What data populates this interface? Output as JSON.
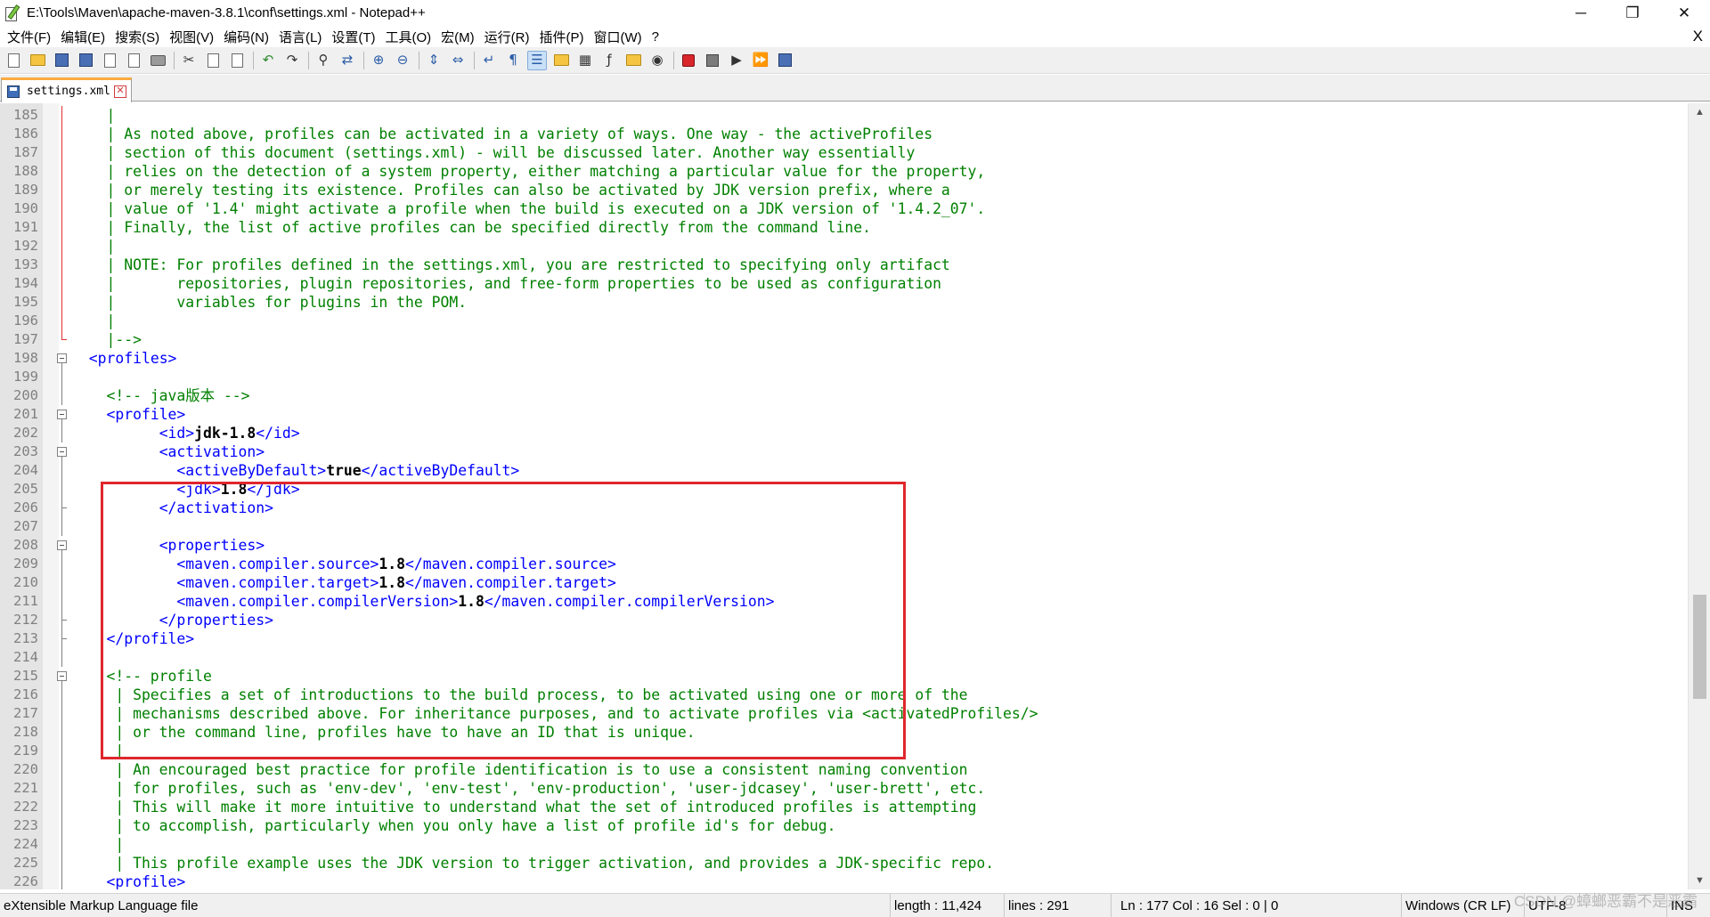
{
  "window": {
    "title": "E:\\Tools\\Maven\\apache-maven-3.8.1\\conf\\settings.xml - Notepad++",
    "minimize_label": "─",
    "restore_label": "❐",
    "close_label": "✕"
  },
  "menu": {
    "items": [
      "文件(F)",
      "编辑(E)",
      "搜索(S)",
      "视图(V)",
      "编码(N)",
      "语言(L)",
      "设置(T)",
      "工具(O)",
      "宏(M)",
      "运行(R)",
      "插件(P)",
      "窗口(W)",
      "?"
    ],
    "close_label": "X"
  },
  "toolbar": {
    "buttons": [
      {
        "name": "new-file-icon",
        "kind": "doc"
      },
      {
        "name": "open-file-icon",
        "kind": "folder"
      },
      {
        "name": "save-icon",
        "kind": "disk"
      },
      {
        "name": "save-all-icon",
        "kind": "disk"
      },
      {
        "name": "close-file-icon",
        "kind": "doc"
      },
      {
        "name": "close-all-icon",
        "kind": "doc"
      },
      {
        "name": "print-icon",
        "kind": "print"
      },
      {
        "sep": true
      },
      {
        "name": "cut-icon",
        "kind": "glyph",
        "glyph": "✂",
        "tone": "dark"
      },
      {
        "name": "copy-icon",
        "kind": "doc"
      },
      {
        "name": "paste-icon",
        "kind": "doc"
      },
      {
        "sep": true
      },
      {
        "name": "undo-icon",
        "kind": "glyph",
        "glyph": "↶",
        "tone": "green"
      },
      {
        "name": "redo-icon",
        "kind": "glyph",
        "glyph": "↷",
        "tone": "dark"
      },
      {
        "sep": true
      },
      {
        "name": "find-icon",
        "kind": "glyph",
        "glyph": "⚲",
        "tone": "dark"
      },
      {
        "name": "replace-icon",
        "kind": "glyph",
        "glyph": "⇄",
        "tone": "blue"
      },
      {
        "sep": true
      },
      {
        "name": "zoom-in-icon",
        "kind": "glyph",
        "glyph": "⊕",
        "tone": "blue"
      },
      {
        "name": "zoom-out-icon",
        "kind": "glyph",
        "glyph": "⊖",
        "tone": "blue"
      },
      {
        "sep": true
      },
      {
        "name": "sync-vertical-icon",
        "kind": "glyph",
        "glyph": "⇕",
        "tone": "blue"
      },
      {
        "name": "sync-horizontal-icon",
        "kind": "glyph",
        "glyph": "⇔",
        "tone": "blue"
      },
      {
        "sep": true
      },
      {
        "name": "word-wrap-icon",
        "kind": "glyph",
        "glyph": "↵",
        "tone": "blue"
      },
      {
        "name": "show-all-chars-icon",
        "kind": "glyph",
        "glyph": "¶",
        "tone": "blue"
      },
      {
        "name": "indent-guide-icon",
        "kind": "glyph",
        "glyph": "☰",
        "tone": "blue",
        "active": true
      },
      {
        "name": "user-language-icon",
        "kind": "folder"
      },
      {
        "name": "document-map-icon",
        "kind": "glyph",
        "glyph": "▦",
        "tone": "dark"
      },
      {
        "name": "function-list-icon",
        "kind": "glyph",
        "glyph": "ƒ",
        "tone": "dark"
      },
      {
        "name": "folder-workspace-icon",
        "kind": "folder"
      },
      {
        "name": "monitoring-icon",
        "kind": "glyph",
        "glyph": "◉",
        "tone": "dark"
      },
      {
        "sep": true
      },
      {
        "name": "record-macro-icon",
        "kind": "red"
      },
      {
        "name": "stop-recording-icon",
        "kind": "gray"
      },
      {
        "name": "playback-macro-icon",
        "kind": "glyph",
        "glyph": "▶",
        "tone": "dark"
      },
      {
        "name": "run-macro-multiple-icon",
        "kind": "glyph",
        "glyph": "⏩",
        "tone": "blue"
      },
      {
        "name": "save-macro-icon",
        "kind": "disk"
      }
    ]
  },
  "tab": {
    "label": "settings.xml",
    "close_label": "✕"
  },
  "editor": {
    "lines": [
      {
        "n": "185",
        "fold": "red",
        "segs": [
          {
            "t": "    |",
            "c": "comment"
          }
        ]
      },
      {
        "n": "186",
        "fold": "red",
        "segs": [
          {
            "t": "    | As noted above, profiles can be activated in a variety of ways. One way - the activeProfiles",
            "c": "comment"
          }
        ]
      },
      {
        "n": "187",
        "fold": "red",
        "segs": [
          {
            "t": "    | section of this document (settings.xml) - will be discussed later. Another way essentially",
            "c": "comment"
          }
        ]
      },
      {
        "n": "188",
        "fold": "red",
        "segs": [
          {
            "t": "    | relies on the detection of a system property, either matching a particular value for the property,",
            "c": "comment"
          }
        ]
      },
      {
        "n": "189",
        "fold": "red",
        "segs": [
          {
            "t": "    | or merely testing its existence. Profiles can also be activated by JDK version prefix, where a",
            "c": "comment"
          }
        ]
      },
      {
        "n": "190",
        "fold": "red",
        "segs": [
          {
            "t": "    | value of '1.4' might activate a profile when the build is executed on a JDK version of '1.4.2_07'.",
            "c": "comment"
          }
        ]
      },
      {
        "n": "191",
        "fold": "red",
        "segs": [
          {
            "t": "    | Finally, the list of active profiles can be specified directly from the command line.",
            "c": "comment"
          }
        ]
      },
      {
        "n": "192",
        "fold": "red",
        "segs": [
          {
            "t": "    |",
            "c": "comment"
          }
        ]
      },
      {
        "n": "193",
        "fold": "red",
        "segs": [
          {
            "t": "    | NOTE: For profiles defined in the settings.xml, you are restricted to specifying only artifact",
            "c": "comment"
          }
        ]
      },
      {
        "n": "194",
        "fold": "red",
        "segs": [
          {
            "t": "    |       repositories, plugin repositories, and free-form properties to be used as configuration",
            "c": "comment"
          }
        ]
      },
      {
        "n": "195",
        "fold": "red",
        "segs": [
          {
            "t": "    |       variables for plugins in the POM.",
            "c": "comment"
          }
        ]
      },
      {
        "n": "196",
        "fold": "red",
        "segs": [
          {
            "t": "    |",
            "c": "comment"
          }
        ]
      },
      {
        "n": "197",
        "fold": "redend",
        "segs": [
          {
            "t": "    |-->",
            "c": "comment"
          }
        ]
      },
      {
        "n": "198",
        "fold": "box",
        "segs": [
          {
            "t": "  ",
            "c": "text"
          },
          {
            "t": "<profiles>",
            "c": "tag"
          }
        ]
      },
      {
        "n": "199",
        "fold": "line",
        "segs": []
      },
      {
        "n": "200",
        "fold": "line",
        "segs": [
          {
            "t": "    <!-- java版本 -->",
            "c": "comment"
          }
        ]
      },
      {
        "n": "201",
        "fold": "box",
        "segs": [
          {
            "t": "    ",
            "c": "text"
          },
          {
            "t": "<profile>",
            "c": "tag"
          }
        ]
      },
      {
        "n": "202",
        "fold": "line",
        "segs": [
          {
            "t": "          ",
            "c": "text"
          },
          {
            "t": "<id>",
            "c": "tag"
          },
          {
            "t": "jdk-1.8",
            "c": "text"
          },
          {
            "t": "</id>",
            "c": "tag"
          }
        ]
      },
      {
        "n": "203",
        "fold": "box",
        "segs": [
          {
            "t": "          ",
            "c": "text"
          },
          {
            "t": "<activation>",
            "c": "tag"
          }
        ]
      },
      {
        "n": "204",
        "fold": "line",
        "segs": [
          {
            "t": "            ",
            "c": "text"
          },
          {
            "t": "<activeByDefault>",
            "c": "tag"
          },
          {
            "t": "true",
            "c": "text"
          },
          {
            "t": "</activeByDefault>",
            "c": "tag"
          }
        ]
      },
      {
        "n": "205",
        "fold": "line",
        "segs": [
          {
            "t": "            ",
            "c": "text"
          },
          {
            "t": "<jdk>",
            "c": "tag"
          },
          {
            "t": "1.8",
            "c": "text"
          },
          {
            "t": "</jdk>",
            "c": "tag"
          }
        ]
      },
      {
        "n": "206",
        "fold": "end",
        "segs": [
          {
            "t": "          ",
            "c": "text"
          },
          {
            "t": "</activation>",
            "c": "tag"
          }
        ]
      },
      {
        "n": "207",
        "fold": "line",
        "segs": []
      },
      {
        "n": "208",
        "fold": "box",
        "segs": [
          {
            "t": "          ",
            "c": "text"
          },
          {
            "t": "<properties>",
            "c": "tag"
          }
        ]
      },
      {
        "n": "209",
        "fold": "line",
        "segs": [
          {
            "t": "            ",
            "c": "text"
          },
          {
            "t": "<maven.compiler.source>",
            "c": "tag"
          },
          {
            "t": "1.8",
            "c": "text"
          },
          {
            "t": "</maven.compiler.source>",
            "c": "tag"
          }
        ]
      },
      {
        "n": "210",
        "fold": "line",
        "segs": [
          {
            "t": "            ",
            "c": "text"
          },
          {
            "t": "<maven.compiler.target>",
            "c": "tag"
          },
          {
            "t": "1.8",
            "c": "text"
          },
          {
            "t": "</maven.compiler.target>",
            "c": "tag"
          }
        ]
      },
      {
        "n": "211",
        "fold": "line",
        "segs": [
          {
            "t": "            ",
            "c": "text"
          },
          {
            "t": "<maven.compiler.compilerVersion>",
            "c": "tag"
          },
          {
            "t": "1.8",
            "c": "text"
          },
          {
            "t": "</maven.compiler.compilerVersion>",
            "c": "tag"
          }
        ]
      },
      {
        "n": "212",
        "fold": "end",
        "segs": [
          {
            "t": "          ",
            "c": "text"
          },
          {
            "t": "</properties>",
            "c": "tag"
          }
        ]
      },
      {
        "n": "213",
        "fold": "end",
        "segs": [
          {
            "t": "    ",
            "c": "text"
          },
          {
            "t": "</profile>",
            "c": "tag"
          }
        ]
      },
      {
        "n": "214",
        "fold": "line",
        "segs": []
      },
      {
        "n": "215",
        "fold": "box",
        "segs": [
          {
            "t": "    <!-- profile",
            "c": "comment"
          }
        ]
      },
      {
        "n": "216",
        "fold": "line",
        "segs": [
          {
            "t": "     | Specifies a set of introductions to the build process, to be activated using one or more of the",
            "c": "comment"
          }
        ]
      },
      {
        "n": "217",
        "fold": "line",
        "segs": [
          {
            "t": "     | mechanisms described above. For inheritance purposes, and to activate profiles via <activatedProfiles/>",
            "c": "comment"
          }
        ]
      },
      {
        "n": "218",
        "fold": "line",
        "segs": [
          {
            "t": "     | or the command line, profiles have to have an ID that is unique.",
            "c": "comment"
          }
        ]
      },
      {
        "n": "219",
        "fold": "line",
        "segs": [
          {
            "t": "     |",
            "c": "comment"
          }
        ]
      },
      {
        "n": "220",
        "fold": "line",
        "segs": [
          {
            "t": "     | An encouraged best practice for profile identification is to use a consistent naming convention",
            "c": "comment"
          }
        ]
      },
      {
        "n": "221",
        "fold": "line",
        "segs": [
          {
            "t": "     | for profiles, such as 'env-dev', 'env-test', 'env-production', 'user-jdcasey', 'user-brett', etc.",
            "c": "comment"
          }
        ]
      },
      {
        "n": "222",
        "fold": "line",
        "segs": [
          {
            "t": "     | This will make it more intuitive to understand what the set of introduced profiles is attempting",
            "c": "comment"
          }
        ]
      },
      {
        "n": "223",
        "fold": "line",
        "segs": [
          {
            "t": "     | to accomplish, particularly when you only have a list of profile id's for debug.",
            "c": "comment"
          }
        ]
      },
      {
        "n": "224",
        "fold": "line",
        "segs": [
          {
            "t": "     |",
            "c": "comment"
          }
        ]
      },
      {
        "n": "225",
        "fold": "line",
        "segs": [
          {
            "t": "     | This profile example uses the JDK version to trigger activation, and provides a JDK-specific repo.",
            "c": "comment"
          }
        ]
      },
      {
        "n": "226",
        "fold": "line",
        "segs": [
          {
            "t": "    ",
            "c": "text"
          },
          {
            "t": "<profile>",
            "c": "tag"
          }
        ]
      }
    ]
  },
  "scrollbar": {
    "up_label": "▲",
    "down_label": "▼"
  },
  "statusbar": {
    "file_type": "eXtensible Markup Language file",
    "length": "length : 11,424",
    "lines": "lines : 291",
    "position": "Ln : 177    Col : 16    Sel : 0 | 0",
    "eol": "Windows (CR LF)",
    "encoding": "UTF-8",
    "mode": "INS"
  },
  "watermark": "CSDN @蟑螂恶霸不是恶霸",
  "colors": {
    "comment": "#008000",
    "tag": "#0000ff",
    "text": "#000000",
    "highlight_box": "#e0262d",
    "tab_accent": "#fbaa3e"
  }
}
